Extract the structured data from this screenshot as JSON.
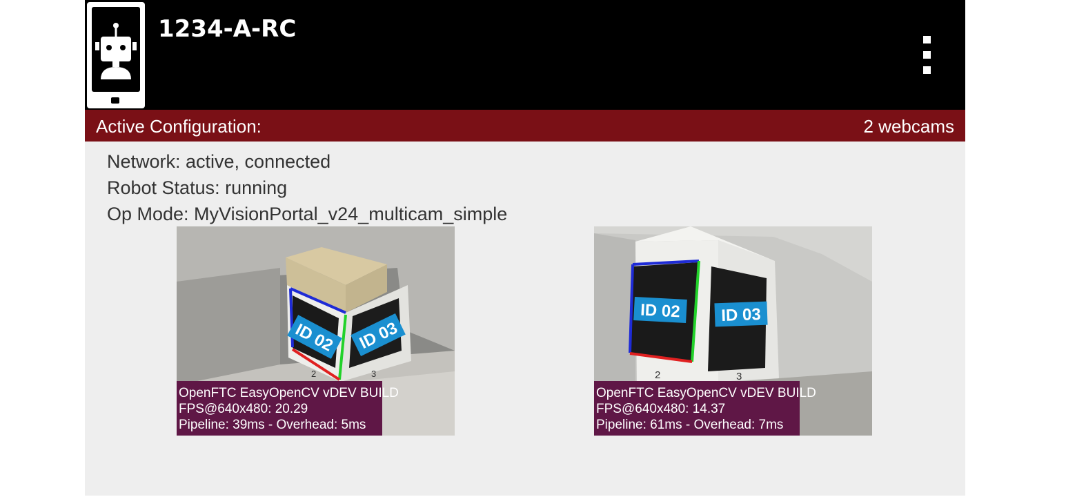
{
  "header": {
    "title": "1234-A-RC",
    "menu_icon": "more-vert-icon",
    "app_icon": "robot-phone-icon"
  },
  "config": {
    "label": "Active Configuration:",
    "value": "2 webcams",
    "bar_color": "#7a1016"
  },
  "status": {
    "network": "Network: active, connected",
    "robot": "Robot Status: running",
    "opmode": "Op Mode: MyVisionPortal_v24_multicam_simple"
  },
  "cameras": [
    {
      "tags": [
        "ID 02",
        "ID 03"
      ],
      "box_labels": [
        "2",
        "3"
      ],
      "overlay": {
        "line1": "OpenFTC EasyOpenCV vDEV BUILD",
        "line2": "FPS@640x480: 20.29",
        "line3": "Pipeline: 39ms - Overhead: 5ms"
      }
    },
    {
      "tags": [
        "ID 02",
        "ID 03"
      ],
      "box_labels": [
        "2",
        "3"
      ],
      "overlay": {
        "line1": "OpenFTC EasyOpenCV vDEV BUILD",
        "line2": "FPS@640x480: 14.37",
        "line3": "Pipeline: 61ms - Overhead: 7ms"
      }
    }
  ],
  "colors": {
    "tag_label": "#1a8fd0",
    "overlay_bg": "#5f1746"
  }
}
